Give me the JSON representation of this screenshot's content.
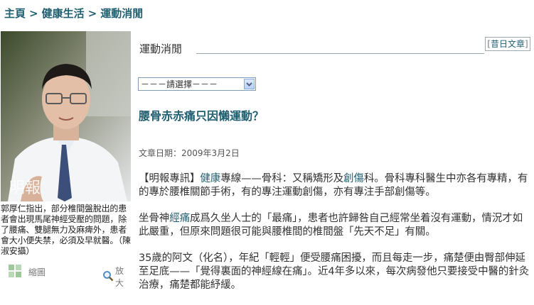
{
  "breadcrumb": {
    "items": [
      "主頁",
      "健康生活",
      "運動消閒"
    ],
    "separator": ">"
  },
  "section": {
    "title": "運動消閒",
    "prev_label": "昔日文章",
    "prev_brackets": [
      "[",
      "]"
    ]
  },
  "select": {
    "value": "－－－請選擇－－－"
  },
  "article": {
    "headline": "腰骨赤赤痛只因懶運動？",
    "date": "文章日期：2009年3月2日",
    "p1": {
      "a": "【明報專訊】",
      "k1": "健康",
      "b": "專線——骨科：又稱矯形及",
      "k2": "創傷",
      "c": "科。骨科專科醫生中亦各有專精，有的專於腰椎關節手術，有的專注運動創傷，亦有專注手部創傷等。"
    },
    "p2": {
      "a": "坐骨神",
      "k1": "經痛",
      "b": "成爲久坐人士的「最痛」，患者也許歸咎自己經常坐着沒有運動，情況才如此嚴重，但原來問題很可能與腰椎間的椎間盤「先天不足」有關。"
    },
    "p3": {
      "text": "35歲的阿文（化名），年紀「輕輕」便受腰痛困擾，而且每走一步，痛楚便由臀部伸延至足底——「覺得裏面的神經線在痛」。近4年多以來，每次病發他只要接受中醫的針灸治療，痛楚都能紓緩。"
    }
  },
  "photo": {
    "caption": "郭厚仁指出，部分椎間盤脫出的患者會出現馬尾神經受壓的問題，除了腰痛、雙腿無力及麻痺外，患者會大小便失禁，必須及早就醫。（陳淑安攝）",
    "watermark": "明報",
    "thumb_label": "縮圖",
    "zoom_label": "放大"
  },
  "colors": {
    "link": "#1f5f70",
    "text": "#333333",
    "rule": "#9ea7ad"
  },
  "icons": [
    "thumbnail-grid-icon",
    "magnifier-icon",
    "dropdown-arrow-icon"
  ]
}
